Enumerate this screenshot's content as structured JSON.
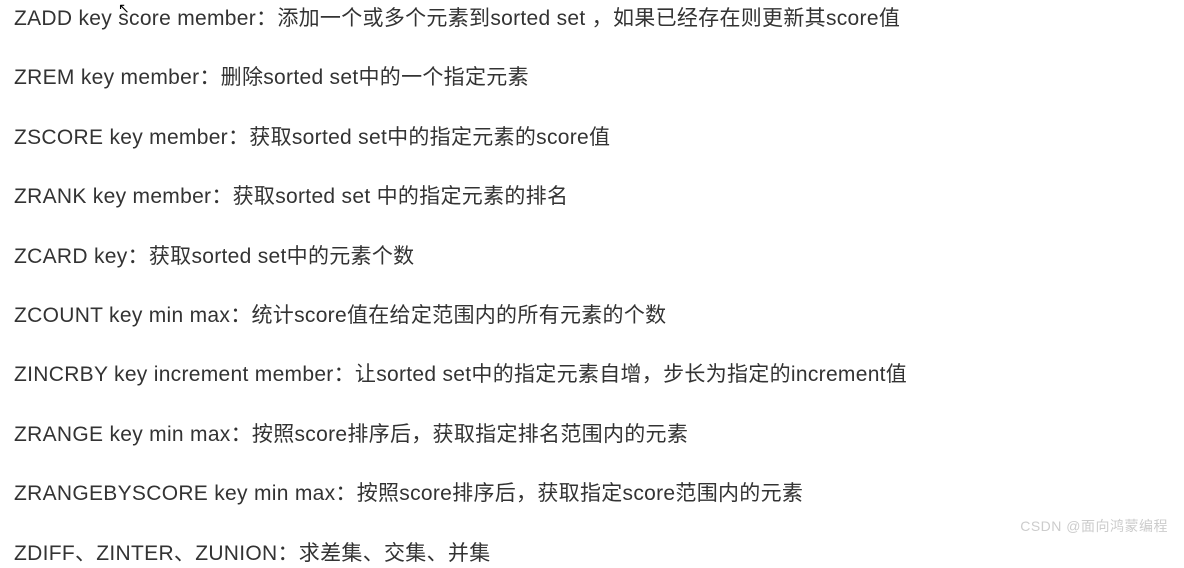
{
  "commands": [
    "ZADD key score member：添加一个或多个元素到sorted set ，如果已经存在则更新其score值",
    "ZREM key member：删除sorted set中的一个指定元素",
    "ZSCORE key member：获取sorted set中的指定元素的score值",
    "ZRANK key member：获取sorted set 中的指定元素的排名",
    "ZCARD key：获取sorted set中的元素个数",
    "ZCOUNT key min max：统计score值在给定范围内的所有元素的个数",
    "ZINCRBY key increment member：让sorted set中的指定元素自增，步长为指定的increment值",
    "ZRANGE key min max：按照score排序后，获取指定排名范围内的元素",
    "ZRANGEBYSCORE key min max：按照score排序后，获取指定score范围内的元素",
    "ZDIFF、ZINTER、ZUNION：求差集、交集、并集"
  ],
  "watermark": "CSDN @面向鸿蒙编程"
}
